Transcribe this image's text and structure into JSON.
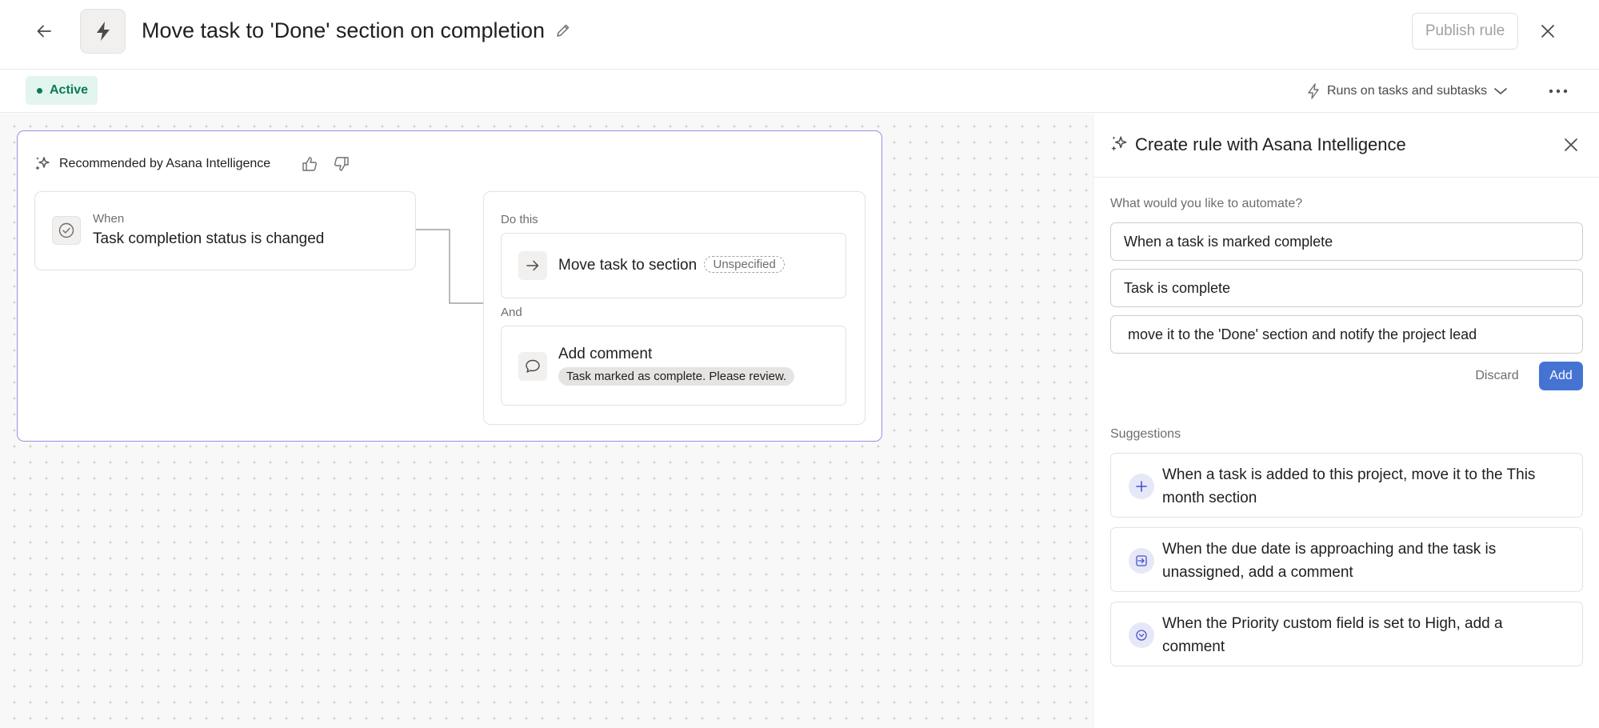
{
  "header": {
    "title": "Move task to 'Done' section on completion",
    "publish_label": "Publish rule"
  },
  "subbar": {
    "status": "Active",
    "runs_on": "Runs on tasks and subtasks"
  },
  "canvas": {
    "recommended_label": "Recommended by Asana Intelligence",
    "trigger": {
      "label": "When",
      "text": "Task completion status is changed"
    },
    "actions": {
      "do_label": "Do this",
      "and_label": "And",
      "move": {
        "title": "Move task to section",
        "placeholder": "Unspecified"
      },
      "comment": {
        "title": "Add comment",
        "text": "Task marked as complete. Please review."
      }
    }
  },
  "panel": {
    "title": "Create rule with Asana Intelligence",
    "question": "What would you like to automate?",
    "fields": {
      "when": "When a task is marked complete",
      "condition": "Task is complete",
      "action": "move it to the 'Done' section and notify the project lead"
    },
    "discard_label": "Discard",
    "add_label": "Add",
    "suggestions_label": "Suggestions",
    "suggestions": [
      {
        "text": "When a task is added to this project, move it to the This month section",
        "icon": "plus-icon"
      },
      {
        "text": "When the due date is approaching and the task is unassigned, add a comment",
        "icon": "move-in-icon"
      },
      {
        "text": "When the Priority custom field is set to High, add a comment",
        "icon": "check-circle-icon"
      }
    ]
  },
  "colors": {
    "accent": "#4573d2",
    "active_bg": "#e2f5ee",
    "active_text": "#0d7a56",
    "ai_border": "#9a90e6"
  }
}
